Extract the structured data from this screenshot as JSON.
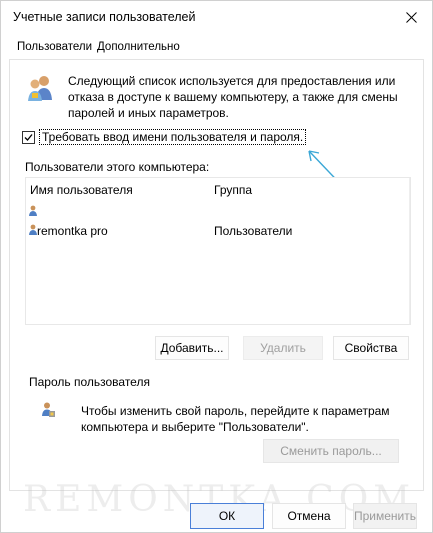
{
  "window": {
    "title": "Учетные записи пользователей"
  },
  "tabs": [
    {
      "label": "Пользователи",
      "active": true
    },
    {
      "label": "Дополнительно",
      "active": false
    }
  ],
  "info": {
    "icon": "users-icon",
    "text": "Следующий список используется для предоставления или отказа в доступе к вашему компьютеру, а также для смены паролей и иных параметров."
  },
  "require_login": {
    "label": "Требовать ввод имени пользователя и пароля.",
    "checked": true
  },
  "users": {
    "section_label": "Пользователи этого компьютера:",
    "columns": [
      "Имя пользователя",
      "Группа"
    ],
    "rows": [
      {
        "name": "",
        "group": ""
      },
      {
        "name": "remontka pro",
        "group": "Пользователи"
      }
    ]
  },
  "user_buttons": {
    "add": "Добавить...",
    "remove": "Удалить",
    "properties": "Свойства"
  },
  "password": {
    "section_label": "Пароль пользователя",
    "icon": "password-icon",
    "text": "Чтобы изменить свой пароль, перейдите к параметрам компьютера и выберите \"Пользователи\".",
    "change_button": "Сменить пароль..."
  },
  "watermark": "REMONTKA.COM",
  "footer": {
    "ok": "ОК",
    "cancel": "Отмена",
    "apply": "Применить"
  },
  "colors": {
    "annotation_arrow": "#3aa7d6",
    "ok_border": "#4a7fd8"
  }
}
